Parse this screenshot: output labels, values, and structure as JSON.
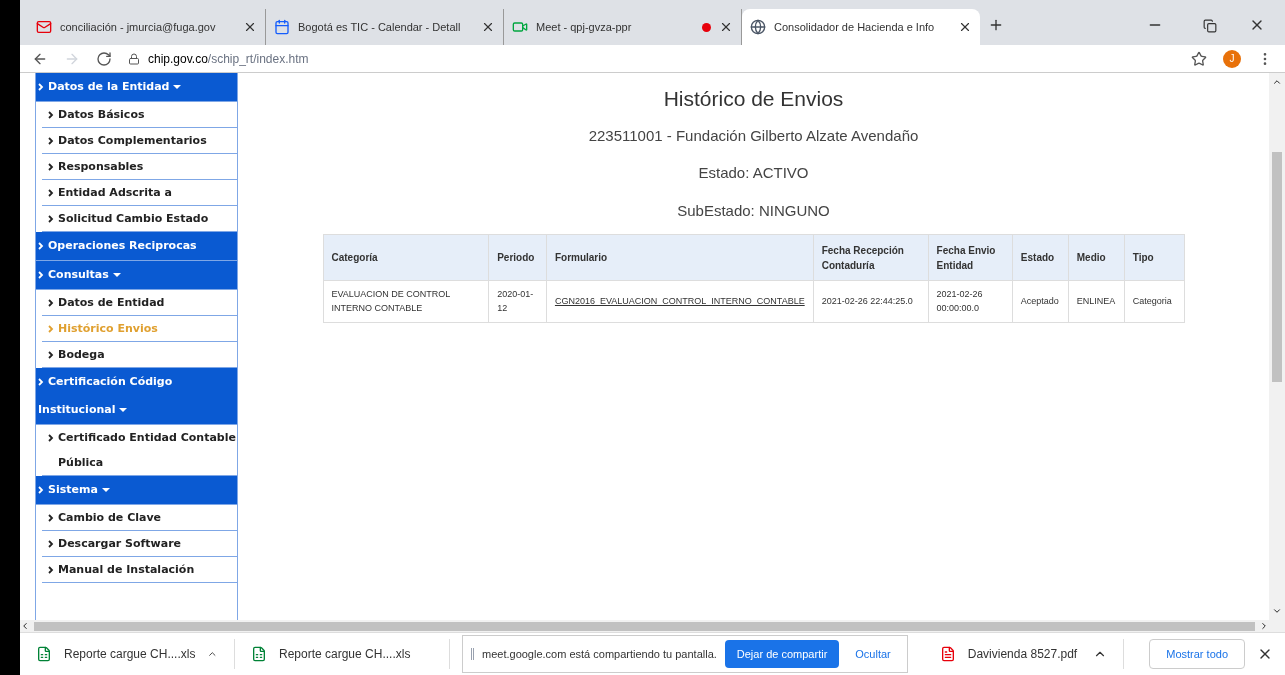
{
  "browser": {
    "tabs": [
      {
        "title": "conciliación - jmurcia@fuga.gov",
        "recording": false,
        "selected": false
      },
      {
        "title": "Bogotá es TIC - Calendar - Detall",
        "recording": false,
        "selected": false
      },
      {
        "title": "Meet - qpj-gvza-ppr",
        "recording": true,
        "selected": false
      },
      {
        "title": "Consolidador de Hacienda e Info",
        "recording": false,
        "selected": true
      }
    ],
    "url": {
      "host": "chip.gov.co",
      "path": "/schip_rt/index.htm"
    },
    "profile": "J"
  },
  "sidebar": [
    {
      "label": "Datos de la Entidad",
      "expanded": true,
      "children": [
        {
          "label": "Datos Básicos",
          "selected": false
        },
        {
          "label": "Datos Complementarios",
          "selected": false
        },
        {
          "label": "Responsables",
          "selected": false
        },
        {
          "label": "Entidad Adscrita a",
          "selected": false
        },
        {
          "label": "Solicitud Cambio Estado",
          "selected": false
        }
      ]
    },
    {
      "label": "Operaciones Reciprocas",
      "expanded": false
    },
    {
      "label": "Consultas",
      "expanded": true,
      "children": [
        {
          "label": "Datos de Entidad",
          "selected": false
        },
        {
          "label": "Histórico Envios",
          "selected": true
        },
        {
          "label": "Bodega",
          "selected": false
        }
      ]
    },
    {
      "label": "Certificación Código Institucional",
      "expanded": true,
      "children": [
        {
          "label": "Certificado Entidad Contable Pública",
          "selected": false
        }
      ]
    },
    {
      "label": "Sistema",
      "expanded": true,
      "children": [
        {
          "label": "Cambio de Clave",
          "selected": false
        },
        {
          "label": "Descargar Software",
          "selected": false
        },
        {
          "label": "Manual de Instalación",
          "selected": false
        }
      ]
    }
  ],
  "main": {
    "title": "Histórico de Envios",
    "entity": "223511001 - Fundación Gilberto Alzate Avendaño",
    "estado": "Estado: ACTIVO",
    "subestado": "SubEstado: NINGUNO",
    "table": {
      "columns": [
        "Categoría",
        "Periodo",
        "Formulario",
        "Fecha Recepción Contaduría",
        "Fecha Envio Entidad",
        "Estado",
        "Medio",
        "Tipo"
      ],
      "rows": [
        [
          "EVALUACION DE CONTROL INTERNO CONTABLE",
          "2020-01-12",
          "CGN2016_EVALUACION_CONTROL_INTERNO_CONTABLE",
          "2021-02-26 22:44:25.0",
          "2021-02-26 00:00:00.0",
          "Aceptado",
          "ENLINEA",
          "Categoria"
        ]
      ]
    }
  },
  "downloads": {
    "items": [
      {
        "name": "Reporte cargue CH....xls",
        "kind": "excel",
        "menu": true
      },
      {
        "name": "Reporte cargue CH....xls",
        "kind": "excel",
        "menu": false
      }
    ],
    "sharing": {
      "message": "meet.google.com está compartiendo tu pantalla.",
      "stop": "Dejar de compartir",
      "hide": "Ocultar"
    },
    "after": [
      {
        "name": "Davivienda 8527.pdf",
        "kind": "pdf",
        "menu": true
      }
    ],
    "show_all": "Mostrar todo"
  }
}
